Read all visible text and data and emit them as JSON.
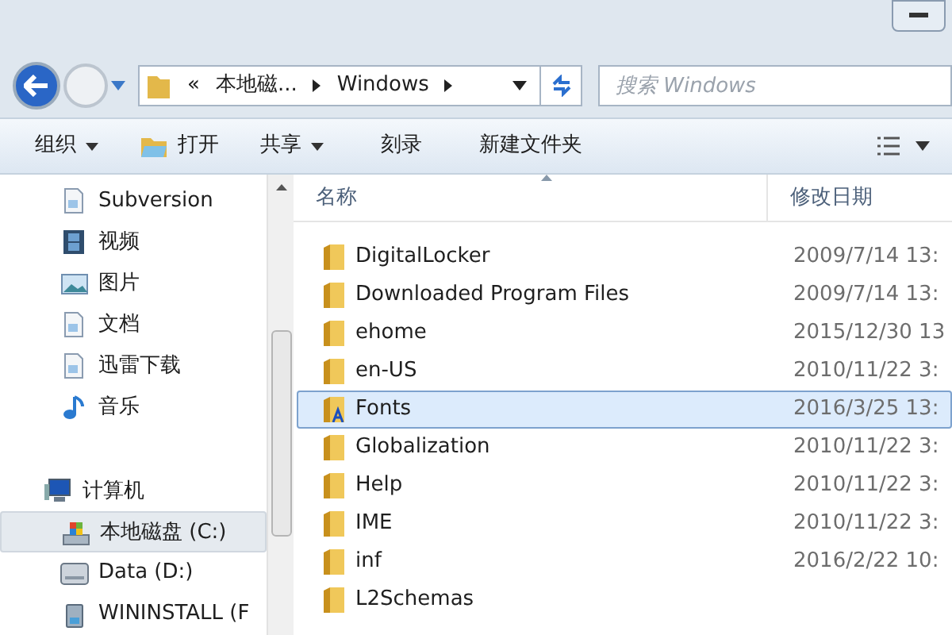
{
  "address_bar": {
    "back_glyph": "«",
    "segments": [
      "本地磁...",
      "Windows"
    ]
  },
  "search": {
    "placeholder": "搜索 Windows"
  },
  "toolbar": [
    {
      "label": "组织",
      "kind": "menu"
    },
    {
      "label": "打开",
      "kind": "icon"
    },
    {
      "label": "共享",
      "kind": "menu"
    },
    {
      "label": "刻录",
      "kind": "plain"
    },
    {
      "label": "新建文件夹",
      "kind": "plain"
    }
  ],
  "sidebar": {
    "items": [
      {
        "label": "Subversion",
        "kind": "doc",
        "selected": false
      },
      {
        "label": "视频",
        "kind": "video",
        "selected": false
      },
      {
        "label": "图片",
        "kind": "picture",
        "selected": false
      },
      {
        "label": "文档",
        "kind": "doc",
        "selected": false
      },
      {
        "label": "迅雷下载",
        "kind": "doc",
        "selected": false
      },
      {
        "label": "音乐",
        "kind": "music",
        "selected": false
      },
      {
        "label": "计算机",
        "kind": "computer",
        "selected": false
      },
      {
        "label": "本地磁盘 (C:)",
        "kind": "drive-c",
        "selected": true
      },
      {
        "label": "Data (D:)",
        "kind": "drive",
        "selected": false
      },
      {
        "label": "WININSTALL (F",
        "kind": "usb",
        "selected": false
      }
    ]
  },
  "table": {
    "columns": [
      "名称",
      "修改日期"
    ],
    "rows": [
      {
        "name": "DigitalLocker",
        "date": "2009/7/14 13:",
        "selected": false
      },
      {
        "name": "Downloaded Program Files",
        "date": "2009/7/14 13:",
        "selected": false
      },
      {
        "name": "ehome",
        "date": "2015/12/30 13",
        "selected": false
      },
      {
        "name": "en-US",
        "date": "2010/11/22 3:",
        "selected": false
      },
      {
        "name": "Fonts",
        "date": "2016/3/25 13:",
        "selected": true
      },
      {
        "name": "Globalization",
        "date": "2010/11/22 3:",
        "selected": false
      },
      {
        "name": "Help",
        "date": "2010/11/22 3:",
        "selected": false
      },
      {
        "name": "IME",
        "date": "2010/11/22 3:",
        "selected": false
      },
      {
        "name": "inf",
        "date": "2016/2/22 10:",
        "selected": false
      },
      {
        "name": "L2Schemas",
        "selected": false
      }
    ]
  }
}
